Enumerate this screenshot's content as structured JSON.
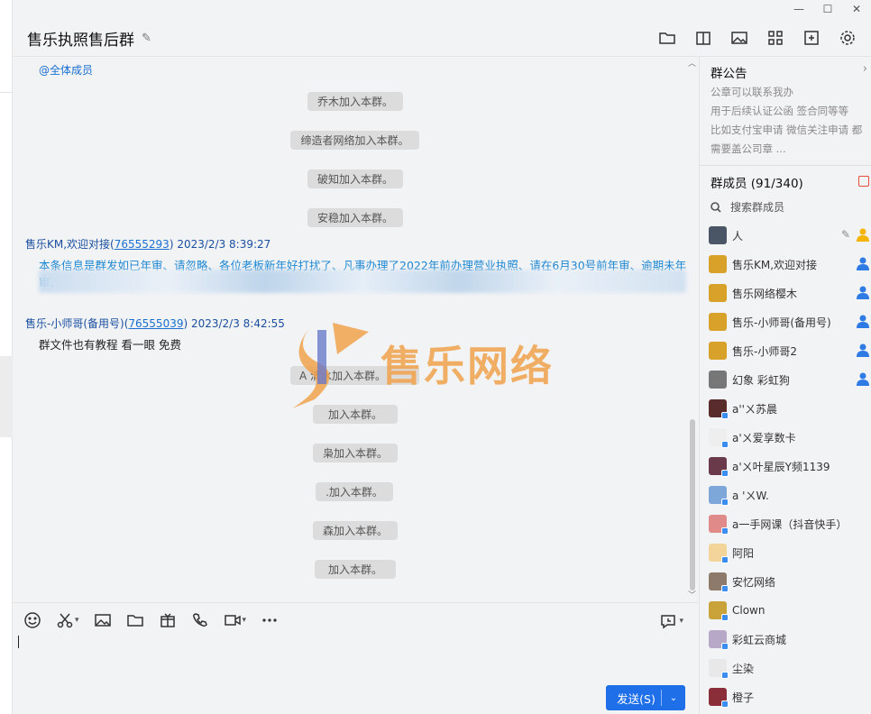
{
  "window": {
    "min": "—",
    "max": "☐",
    "close": "✕"
  },
  "header": {
    "title": "售乐执照售后群"
  },
  "chat": {
    "at_all": "@全体成员",
    "system_top": [
      "乔木加入本群。",
      "缔造者网络加入本群。",
      "破知加入本群。",
      "安稳加入本群。"
    ],
    "msg1": {
      "sender": "售乐KM,欢迎对接",
      "qq": "76555293",
      "time": "2023/2/3 8:39:27",
      "text": "本条信息是群发如已年审、请忽略、各位老板新年好打扰了、凡事办理了2022年前办理营业执照、请在6月30号前年审、逾期未年审、"
    },
    "msg2": {
      "sender": "售乐-小师哥(备用号)",
      "qq": "76555039",
      "time": "2023/2/3 8:42:55",
      "text": "群文件也有教程 看一眼 免费"
    },
    "system_bottom": [
      "A      清水加入本群。",
      "加入本群。",
      "枭加入本群。",
      ".加入本群。",
      "森加入本群。",
      "加入本群。"
    ],
    "watermark": "售乐网络"
  },
  "composer": {
    "send_label": "发送(S)"
  },
  "sidebar": {
    "notice_title": "群公告",
    "notice_lines": [
      "公章可以联系我办",
      "用于后续认证公函 签合同等等",
      "比如支付宝申请 微信关注申请 都",
      "需要盖公司章 ..."
    ],
    "members_title": "群成员 (91/340)",
    "search_placeholder": "搜索群成员",
    "members": [
      {
        "name": "人",
        "role": "owner",
        "color": "#4a5566"
      },
      {
        "name": "售乐KM,欢迎对接",
        "role": "admin",
        "color": "#d7a12a"
      },
      {
        "name": "售乐网络樱木",
        "role": "admin",
        "color": "#d7a12a"
      },
      {
        "name": "售乐-小师哥(备用号)",
        "role": "admin",
        "color": "#d7a12a"
      },
      {
        "name": "售乐-小师哥2",
        "role": "admin",
        "color": "#d7a12a"
      },
      {
        "name": "幻象 彩虹狗",
        "role": "admin",
        "color": "#777777"
      },
      {
        "name": "a''ㄨ苏晨",
        "role": "",
        "color": "#5a2b2b"
      },
      {
        "name": "a'ㄨ爱享数卡",
        "role": "",
        "color": "#eeeeee"
      },
      {
        "name": "a'ㄨ叶星辰Y频1139",
        "role": "",
        "color": "#6b3a4a"
      },
      {
        "name": "a 'ㄨW.",
        "role": "",
        "color": "#7da6d9"
      },
      {
        "name": "a一手网课（抖音快手）",
        "role": "",
        "color": "#e08a8a"
      },
      {
        "name": "阿阳",
        "role": "",
        "color": "#f3d59a"
      },
      {
        "name": "安忆网络",
        "role": "",
        "color": "#8d7a6a"
      },
      {
        "name": "Clown",
        "role": "",
        "color": "#c9a23a"
      },
      {
        "name": "彩虹云商城",
        "role": "",
        "color": "#b8a8c8"
      },
      {
        "name": "尘染",
        "role": "",
        "color": "#e8e8e8"
      },
      {
        "name": "橙子",
        "role": "",
        "color": "#8a2f3a"
      }
    ]
  }
}
